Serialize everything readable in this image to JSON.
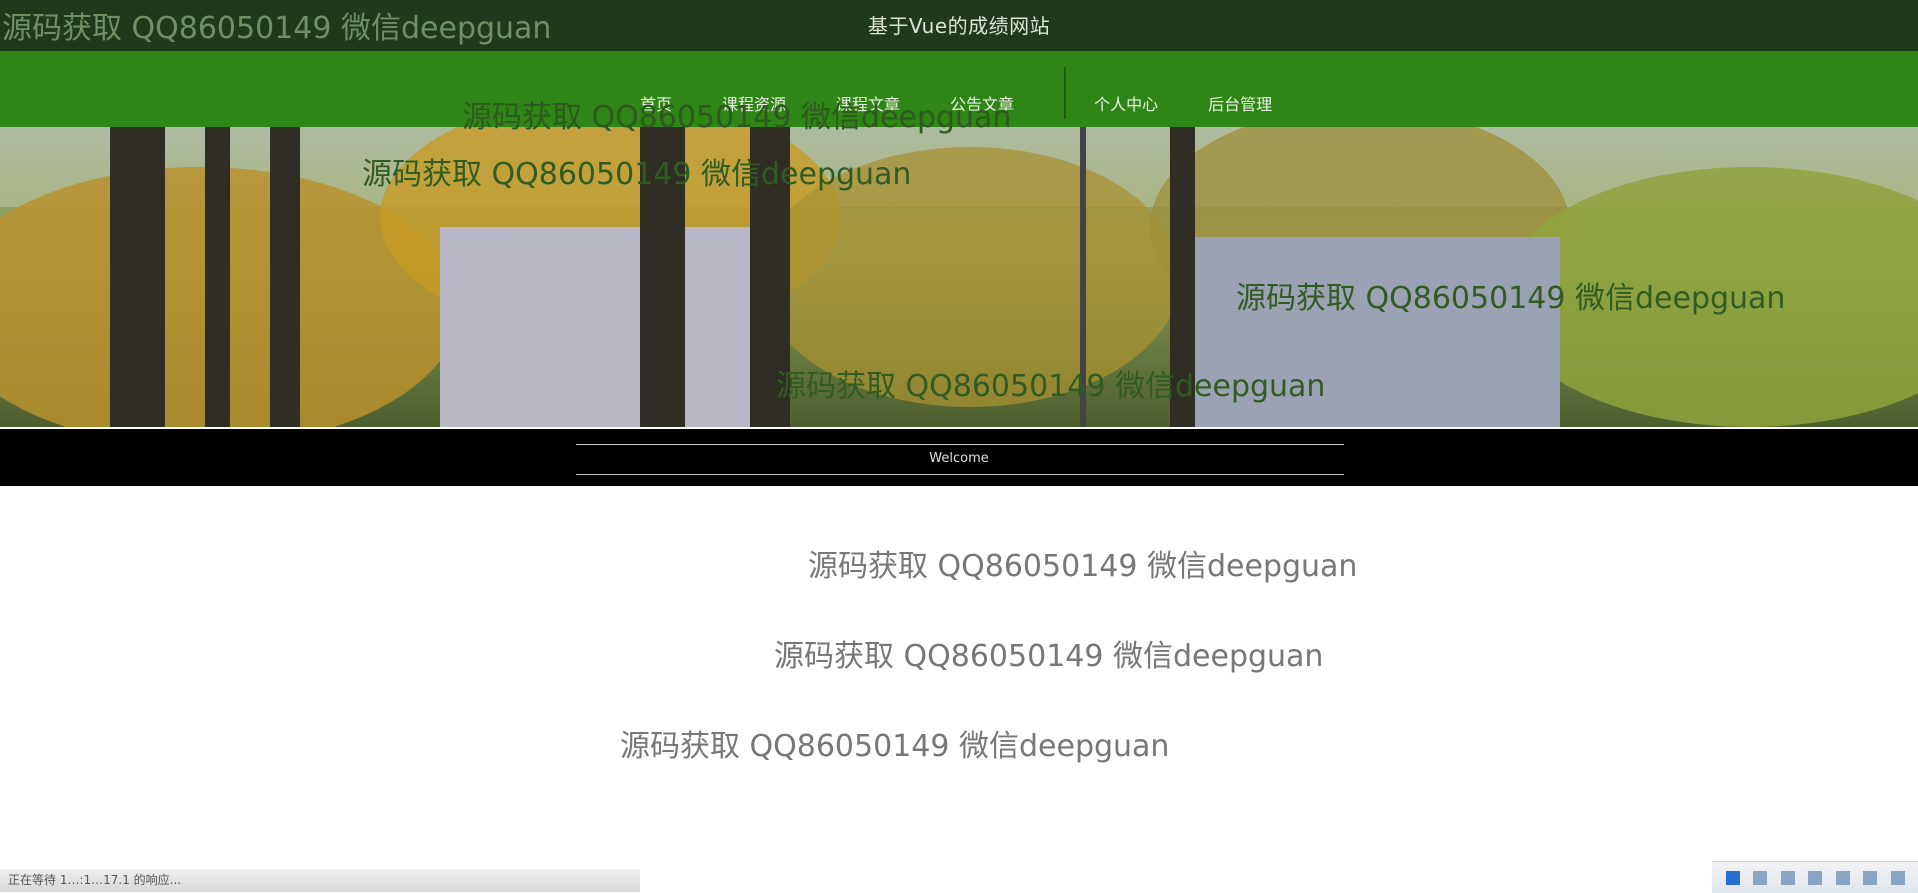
{
  "header": {
    "site_title": "基于Vue的成绩网站"
  },
  "nav": {
    "items": [
      "首页",
      "课程资源",
      "课程文章",
      "公告文章",
      "个人中心",
      "后台管理"
    ]
  },
  "banner": {
    "welcome_text": "Welcome"
  },
  "watermark": {
    "text": "源码获取 QQ86050149 微信deepguan"
  },
  "statusbar": {
    "text": "正在等待 1…:1…17.1 的响应..."
  },
  "tray": {
    "icons": [
      "ime-icon",
      "lang-icon",
      "tool-icon",
      "moon-icon",
      "keyboard-icon",
      "settings-icon",
      "wrench-icon"
    ]
  },
  "colors": {
    "topbar": "#1f3a1a",
    "navbar": "#2f8515",
    "welcome_bar": "#000000",
    "watermark": "#777777"
  }
}
